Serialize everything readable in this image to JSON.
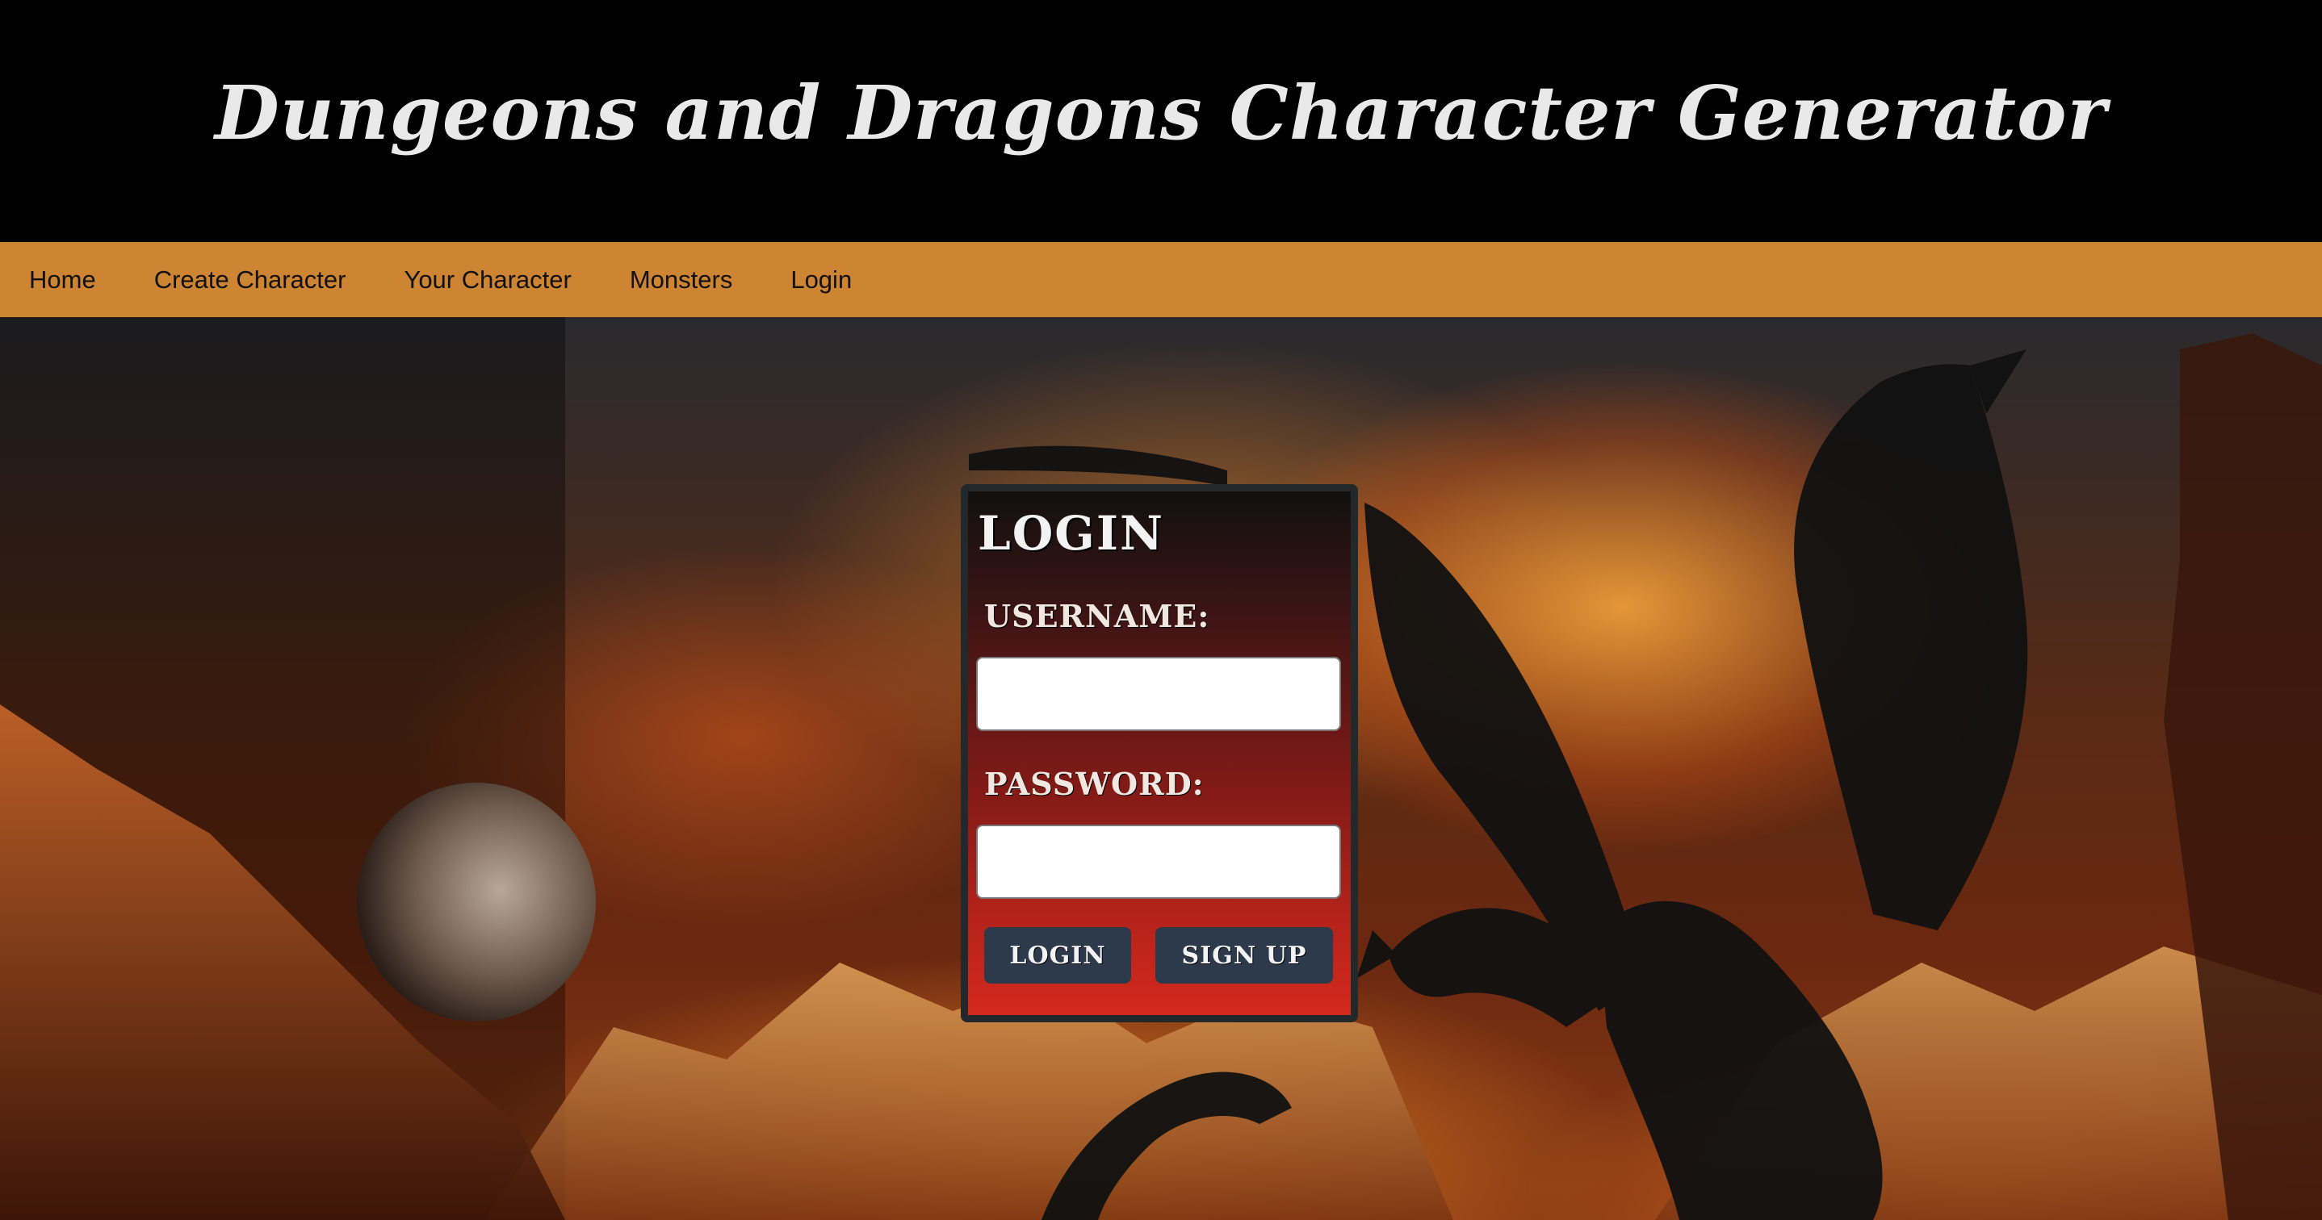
{
  "header": {
    "title": "Dungeons and Dragons Character Generator"
  },
  "nav": {
    "items": [
      {
        "label": "Home"
      },
      {
        "label": "Create Character"
      },
      {
        "label": "Your Character"
      },
      {
        "label": "Monsters"
      },
      {
        "label": "Login"
      }
    ]
  },
  "login_form": {
    "heading": "LOGIN",
    "username_label": "USERNAME:",
    "username_value": "",
    "password_label": "PASSWORD:",
    "password_value": "",
    "login_button": "LOGIN",
    "signup_button": "SIGN UP"
  },
  "colors": {
    "header_bg": "#000000",
    "nav_bg": "#cd8433",
    "title_text": "#e9e9e9",
    "button_bg": "#2c3a4b",
    "panel_border": "#23282a"
  }
}
